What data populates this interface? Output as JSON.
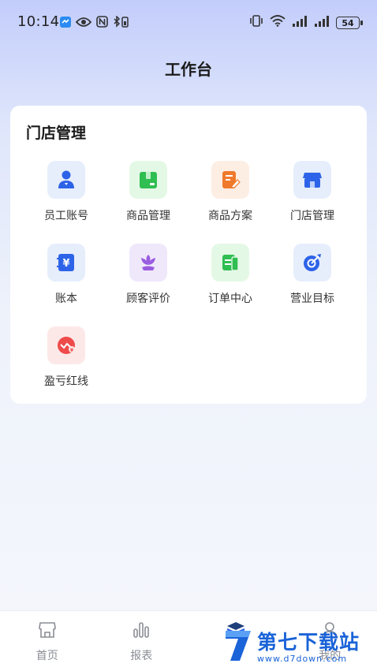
{
  "status_bar": {
    "time": "10:14",
    "battery": "54"
  },
  "header": {
    "title": "工作台"
  },
  "section": {
    "title": "门店管理",
    "items": [
      {
        "label": "员工账号",
        "icon": "employee-account-icon",
        "bg": "#e6eefc",
        "color": "#2d63e8"
      },
      {
        "label": "商品管理",
        "icon": "product-management-icon",
        "bg": "#e4f8e6",
        "color": "#2fbe52"
      },
      {
        "label": "商品方案",
        "icon": "product-plan-icon",
        "bg": "#fdeee4",
        "color": "#f07a2c"
      },
      {
        "label": "门店管理",
        "icon": "store-management-icon",
        "bg": "#e6eefc",
        "color": "#2d63e8"
      },
      {
        "label": "账本",
        "icon": "ledger-icon",
        "bg": "#e6eefc",
        "color": "#2d63e8"
      },
      {
        "label": "顾客评价",
        "icon": "customer-review-icon",
        "bg": "#efe8fb",
        "color": "#9a5ce0"
      },
      {
        "label": "订单中心",
        "icon": "order-center-icon",
        "bg": "#e4f8e6",
        "color": "#2fbe52"
      },
      {
        "label": "营业目标",
        "icon": "business-target-icon",
        "bg": "#e6eefc",
        "color": "#2d63e8"
      },
      {
        "label": "盈亏红线",
        "icon": "profit-loss-icon",
        "bg": "#fde8e8",
        "color": "#ee4b4b"
      }
    ]
  },
  "tabbar": {
    "items": [
      {
        "label": "首页",
        "icon": "home-store-icon"
      },
      {
        "label": "报表",
        "icon": "report-bars-icon"
      },
      {
        "label": "",
        "icon": "workbench-icon"
      },
      {
        "label": "我的",
        "icon": "profile-icon"
      }
    ]
  },
  "watermark": {
    "name": "第七下载站",
    "url": "www.d7down.com"
  }
}
